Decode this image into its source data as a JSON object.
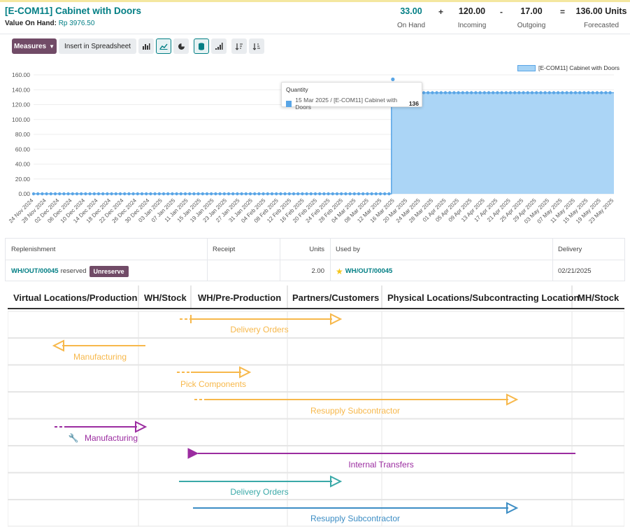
{
  "header": {
    "title": "[E-COM11] Cabinet with Doors",
    "value_label": "Value On Hand:",
    "value": "Rp 3976.50",
    "on_hand": "33.00",
    "on_hand_label": "On Hand",
    "op1": "+",
    "incoming": "120.00",
    "incoming_label": "Incoming",
    "op2": "-",
    "outgoing": "17.00",
    "outgoing_label": "Outgoing",
    "op3": "=",
    "forecasted": "136.00 Units",
    "forecasted_label": "Forecasted"
  },
  "toolbar": {
    "measures_label": "Measures",
    "spreadsheet_label": "Insert in Spreadsheet"
  },
  "chart_data": {
    "type": "area",
    "ylim": [
      0,
      160
    ],
    "yticks": [
      "0.00",
      "20.00",
      "40.00",
      "60.00",
      "80.00",
      "100.00",
      "120.00",
      "140.00",
      "160.00"
    ],
    "xticks": [
      "24 Nov 2024",
      "28 Nov 2024",
      "02 Dec 2024",
      "06 Dec 2024",
      "10 Dec 2024",
      "14 Dec 2024",
      "18 Dec 2024",
      "22 Dec 2024",
      "26 Dec 2024",
      "30 Dec 2024",
      "03 Jan 2025",
      "07 Jan 2025",
      "11 Jan 2025",
      "15 Jan 2025",
      "19 Jan 2025",
      "23 Jan 2025",
      "27 Jan 2025",
      "31 Jan 2025",
      "04 Feb 2025",
      "08 Feb 2025",
      "12 Feb 2025",
      "16 Feb 2025",
      "20 Feb 2025",
      "24 Feb 2025",
      "28 Feb 2025",
      "04 Mar 2025",
      "08 Mar 2025",
      "12 Mar 2025",
      "16 Mar 2025",
      "20 Mar 2025",
      "24 Mar 2025",
      "28 Mar 2025",
      "01 Apr 2025",
      "05 Apr 2025",
      "09 Apr 2025",
      "13 Apr 2025",
      "17 Apr 2025",
      "21 Apr 2025",
      "25 Apr 2025",
      "29 Apr 2025",
      "03 May 2025",
      "07 May 2025",
      "11 May 2025",
      "15 May 2025",
      "19 May 2025",
      "23 May 2025"
    ],
    "series": [
      {
        "name": "[E-COM11] Cabinet with Doors",
        "start_value": 0,
        "step_date": "15 Mar 2025",
        "step_value": 136,
        "end_value": 136
      }
    ],
    "legend": "top-right",
    "color": "#59a5e6",
    "tooltip": {
      "title": "Quantity",
      "label": "15 Mar 2025 / [E-COM11] Cabinet with Doors",
      "value": "136"
    }
  },
  "table": {
    "headers": [
      "Replenishment",
      "Receipt",
      "Units",
      "Used by",
      "Delivery"
    ],
    "row": {
      "replenishment_ref": "WH/OUT/00045",
      "replenishment_state": "reserved",
      "unreserve_label": "Unreserve",
      "receipt": "",
      "units": "2.00",
      "used_by": "WH/OUT/00045",
      "delivery": "02/21/2025"
    }
  },
  "routes": {
    "columns": [
      "Virtual Locations/Production",
      "WH/Stock",
      "WH/Pre-Production",
      "Partners/Customers",
      "Physical Locations/Subcontracting Location",
      "MH/Stock"
    ],
    "rows": [
      {
        "label": "Delivery Orders",
        "color": "#f7b84b"
      },
      {
        "label": "Manufacturing",
        "color": "#f7b84b"
      },
      {
        "label": "Pick Components",
        "color": "#f7b84b"
      },
      {
        "label": "Resupply Subcontractor",
        "color": "#f7b84b"
      },
      {
        "label": "Manufacturing",
        "color": "#9b2ca0"
      },
      {
        "label": "Internal Transfers",
        "color": "#9b2ca0"
      },
      {
        "label": "Delivery Orders",
        "color": "#3aa9a8"
      },
      {
        "label": "Resupply Subcontractor",
        "color": "#3c8dc4"
      }
    ],
    "wrench_icon": "wrench-icon"
  }
}
